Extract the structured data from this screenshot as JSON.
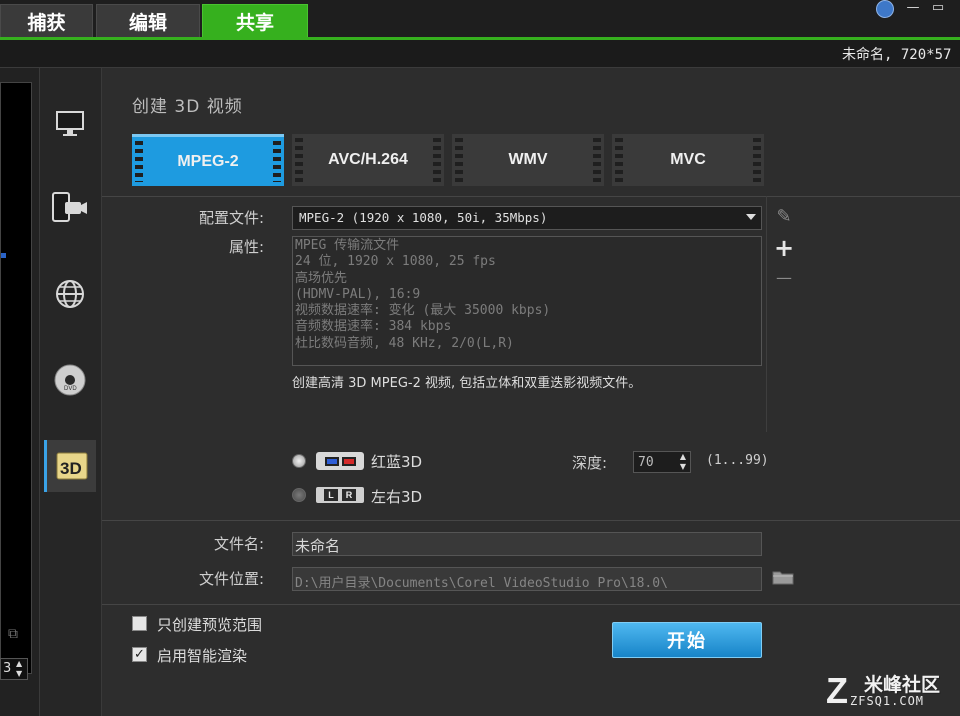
{
  "tabs": [
    {
      "label": "捕获"
    },
    {
      "label": "编辑"
    },
    {
      "label": "共享"
    }
  ],
  "window": {
    "minimize": "—",
    "maximize": "▭"
  },
  "project_info": "未命名, 720*57",
  "preview": {
    "counter": "3"
  },
  "sidebar": {
    "items": [
      {
        "name": "computer",
        "icon": "monitor-icon"
      },
      {
        "name": "device",
        "icon": "mobile-device-icon"
      },
      {
        "name": "web",
        "icon": "globe-icon"
      },
      {
        "name": "disc",
        "icon": "dvd-disc-icon"
      },
      {
        "name": "3d",
        "icon": "3d-icon",
        "label": "3D",
        "active": true
      }
    ]
  },
  "section_title": "创建 3D 视频",
  "formats": [
    {
      "label": "MPEG-2",
      "active": true
    },
    {
      "label": "AVC/H.264"
    },
    {
      "label": "WMV"
    },
    {
      "label": "MVC"
    }
  ],
  "profile": {
    "label": "配置文件:",
    "value": "MPEG-2 (1920 x 1080, 50i, 35Mbps)"
  },
  "properties": {
    "label": "属性:",
    "lines": [
      "MPEG 传输流文件",
      "24 位, 1920 x 1080, 25 fps",
      "高场优先",
      "(HDMV-PAL), 16:9",
      "视频数据速率: 变化 (最大 35000 kbps)",
      "音频数据速率: 384 kbps",
      "杜比数码音频, 48 KHz, 2/0(L,R)"
    ]
  },
  "tools": {
    "edit": "✎",
    "add": "+",
    "remove": "—"
  },
  "description": "创建高清 3D MPEG-2 视频, 包括立体和双重迭影视频文件。",
  "mode_3d": {
    "anaglyph_label": "红蓝3D",
    "side_by_side_label": "左右3D",
    "lr_left": "L",
    "lr_right": "R"
  },
  "depth": {
    "label": "深度:",
    "value": "70",
    "range": "(1...99)"
  },
  "file_name": {
    "label": "文件名:",
    "value": "未命名"
  },
  "file_location": {
    "label": "文件位置:",
    "value": "D:\\用户目录\\Documents\\Corel VideoStudio Pro\\18.0\\"
  },
  "options": {
    "preview_range_label": "只创建预览范围",
    "preview_range_checked": false,
    "smart_render_label": "启用智能渲染",
    "smart_render_checked": true
  },
  "start_button": "开始",
  "watermark": {
    "logo_letter": "Z",
    "text": "米峰社区",
    "url": "ZFSQ1.COM"
  },
  "colors": {
    "accent_green": "#36b01e",
    "accent_blue": "#1e9be0",
    "background": "#2d2d2d"
  }
}
